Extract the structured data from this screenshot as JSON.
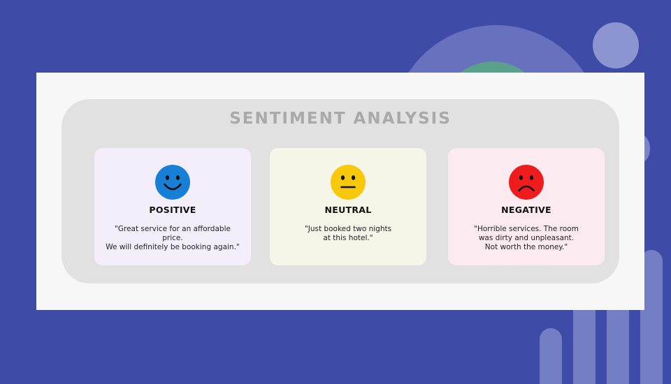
{
  "title": "SENTIMENT ANALYSIS",
  "cards": [
    {
      "key": "positive",
      "label": "POSITIVE",
      "face_icon": "smiling-face-icon",
      "face_color": "#1780d6",
      "quote_lines": [
        "\"Great service for an affordable",
        "price.",
        "We will definitely be booking again.\""
      ]
    },
    {
      "key": "neutral",
      "label": "NEUTRAL",
      "face_icon": "neutral-face-icon",
      "face_color": "#f7c90a",
      "quote_lines": [
        "\"Just booked two nights",
        "at this hotel.\""
      ]
    },
    {
      "key": "negative",
      "label": "NEGATIVE",
      "face_icon": "frowning-face-icon",
      "face_color": "#ee1c1c",
      "quote_lines": [
        "\"Horrible services. The room",
        "was dirty and unpleasant.",
        "Not worth the money.\""
      ]
    }
  ],
  "colors": {
    "background": "#3e4ba7",
    "panel": "#e1e1e1",
    "title": "#a9a9a9"
  }
}
